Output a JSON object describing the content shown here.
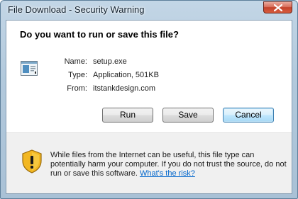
{
  "window": {
    "title": "File Download - Security Warning"
  },
  "dialog": {
    "question": "Do you want to run or save this file?",
    "file": {
      "name_label": "Name:",
      "name_value": "setup.exe",
      "type_label": "Type:",
      "type_value": "Application, 501KB",
      "from_label": "From:",
      "from_value": "itstankdesign.com"
    },
    "buttons": {
      "run": "Run",
      "save": "Save",
      "cancel": "Cancel"
    },
    "warning": {
      "text": "While files from the Internet can be useful, this file type can potentially harm your computer. If you do not trust the source, do not run or save this software.",
      "link": "What's the risk?"
    }
  },
  "icons": {
    "close": "close-icon",
    "file": "application-file-icon",
    "warning": "warning-shield-icon"
  },
  "colors": {
    "link": "#0066cc",
    "close_button": "#c2412b",
    "shield_yellow": "#f2b722"
  }
}
